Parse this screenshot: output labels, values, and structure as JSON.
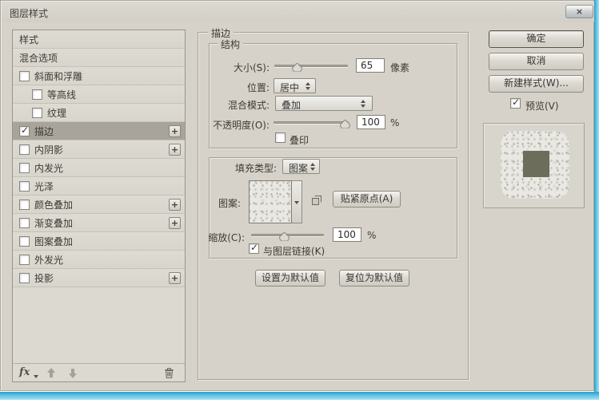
{
  "window": {
    "title": "图层样式",
    "close_glyph": "×"
  },
  "sidebar": {
    "plus_glyph": "+",
    "items": [
      {
        "label": "样式",
        "checkbox": false,
        "checked": false,
        "indent": false,
        "selected": false,
        "plus": false
      },
      {
        "label": "混合选项",
        "checkbox": false,
        "checked": false,
        "indent": false,
        "selected": false,
        "plus": false
      },
      {
        "label": "斜面和浮雕",
        "checkbox": true,
        "checked": false,
        "indent": false,
        "selected": false,
        "plus": false
      },
      {
        "label": "等高线",
        "checkbox": true,
        "checked": false,
        "indent": true,
        "selected": false,
        "plus": false
      },
      {
        "label": "纹理",
        "checkbox": true,
        "checked": false,
        "indent": true,
        "selected": false,
        "plus": false
      },
      {
        "label": "描边",
        "checkbox": true,
        "checked": true,
        "indent": false,
        "selected": true,
        "plus": true
      },
      {
        "label": "内阴影",
        "checkbox": true,
        "checked": false,
        "indent": false,
        "selected": false,
        "plus": true
      },
      {
        "label": "内发光",
        "checkbox": true,
        "checked": false,
        "indent": false,
        "selected": false,
        "plus": false
      },
      {
        "label": "光泽",
        "checkbox": true,
        "checked": false,
        "indent": false,
        "selected": false,
        "plus": false
      },
      {
        "label": "颜色叠加",
        "checkbox": true,
        "checked": false,
        "indent": false,
        "selected": false,
        "plus": true
      },
      {
        "label": "渐变叠加",
        "checkbox": true,
        "checked": false,
        "indent": false,
        "selected": false,
        "plus": true
      },
      {
        "label": "图案叠加",
        "checkbox": true,
        "checked": false,
        "indent": false,
        "selected": false,
        "plus": false
      },
      {
        "label": "外发光",
        "checkbox": true,
        "checked": false,
        "indent": false,
        "selected": false,
        "plus": false
      },
      {
        "label": "投影",
        "checkbox": true,
        "checked": false,
        "indent": false,
        "selected": false,
        "plus": true
      }
    ],
    "footer": {
      "fx_label": "fx"
    }
  },
  "panel": {
    "title": "描边",
    "structure": {
      "group_label": "结构",
      "size_label": "大小(S):",
      "size_value": "65",
      "size_unit": "像素",
      "position_label": "位置:",
      "position_value": "居中",
      "blend_mode_label": "混合模式:",
      "blend_mode_value": "叠加",
      "opacity_label": "不透明度(O):",
      "opacity_value": "100",
      "opacity_unit": "%",
      "overprint_label": "叠印",
      "overprint_checked": false
    },
    "fill": {
      "fill_type_label": "填充类型:",
      "fill_type_value": "图案",
      "pattern_label": "图案:",
      "snap_origin_label": "贴紧原点(A)",
      "scale_label": "缩放(C):",
      "scale_value": "100",
      "scale_unit": "%",
      "link_label": "与图层链接(K)",
      "link_checked": true
    },
    "make_default_label": "设置为默认值",
    "reset_default_label": "复位为默认值"
  },
  "actions": {
    "ok": "确定",
    "cancel": "取消",
    "new_style": "新建样式(W)...",
    "preview_label": "预览(V)",
    "preview_checked": true
  },
  "colors": {
    "dialog_bg": "#d6d2c9",
    "selected_row_bg": "#a8a49c",
    "frame_accent": "#5fc4e4",
    "preview_square": "#6d6d5c"
  }
}
